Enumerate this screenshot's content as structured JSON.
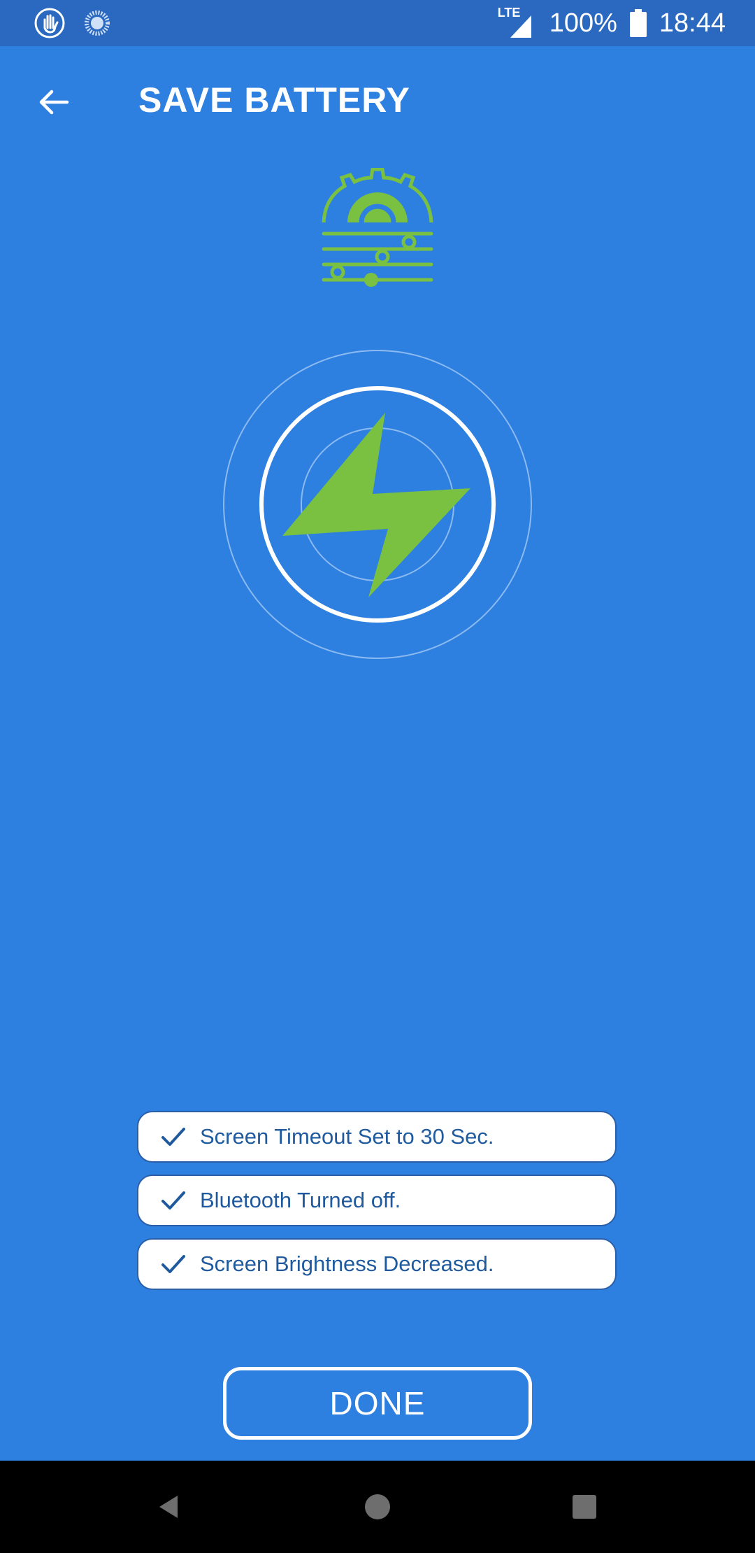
{
  "status_bar": {
    "network": "LTE",
    "battery_percent": "100%",
    "time": "18:44",
    "icons": [
      "hand-icon",
      "loading-icon",
      "signal-icon",
      "battery-icon"
    ]
  },
  "app_bar": {
    "title": "SAVE BATTERY",
    "back_icon": "arrow-back-icon"
  },
  "illustration": {
    "top_icon": "gear-sliders-icon",
    "center_icon": "lightning-bolt-icon",
    "accent_color": "#7ac142"
  },
  "checklist": [
    {
      "icon": "checkmark-icon",
      "label": "Screen Timeout Set to 30 Sec."
    },
    {
      "icon": "checkmark-icon",
      "label": "Bluetooth Turned off."
    },
    {
      "icon": "checkmark-icon",
      "label": "Screen Brightness Decreased."
    }
  ],
  "done_button": {
    "label": "DONE"
  },
  "colors": {
    "background": "#2d7fe0",
    "status_bar": "#2a69bf",
    "item_text": "#1f5a9e",
    "white": "#ffffff"
  },
  "nav_bar": {
    "icons": [
      "nav-back-icon",
      "nav-home-icon",
      "nav-recents-icon"
    ]
  }
}
